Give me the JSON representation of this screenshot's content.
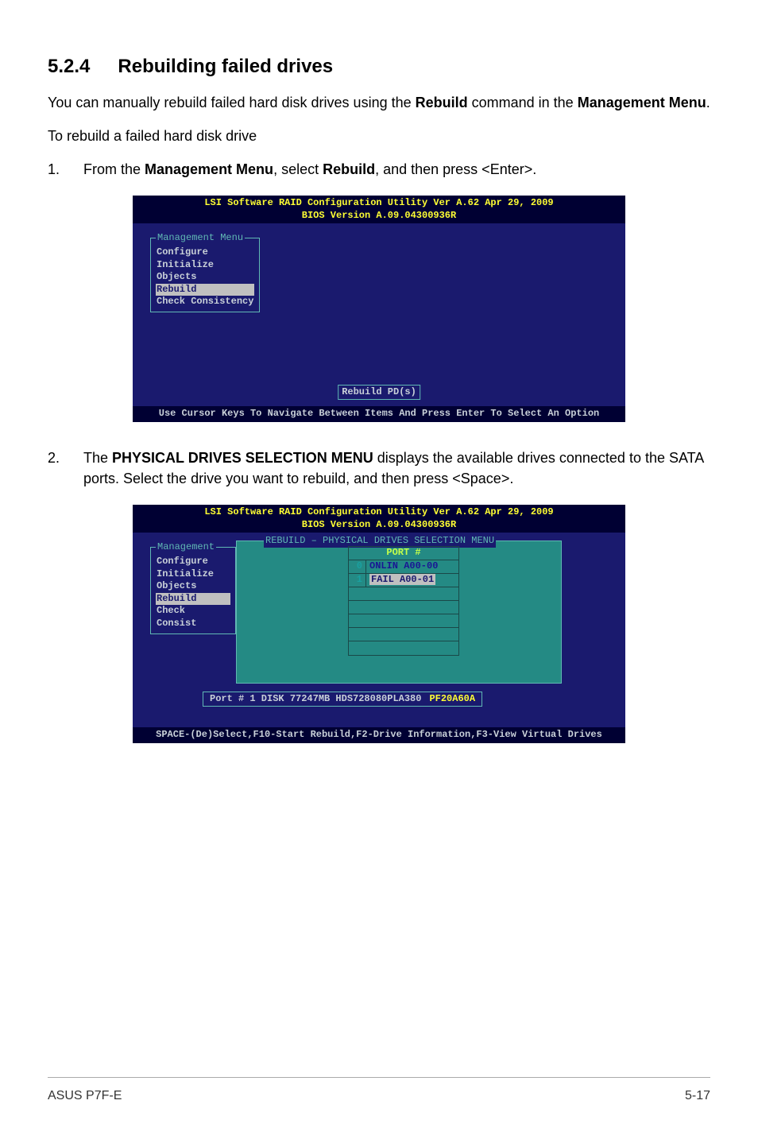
{
  "heading": {
    "number": "5.2.4",
    "title": "Rebuilding failed drives"
  },
  "intro1": "You can manually rebuild failed hard disk drives using the ",
  "intro1_bold1": "Rebuild",
  "intro1_mid": " command in the ",
  "intro1_bold2": "Management Menu",
  "intro1_end": ".",
  "intro2": "To rebuild a failed hard disk drive",
  "step1": {
    "num": "1.",
    "pre": "From the ",
    "b1": "Management Menu",
    "mid": ", select ",
    "b2": "Rebuild",
    "post": ", and then press <Enter>."
  },
  "bios1": {
    "header1": "LSI Software RAID Configuration Utility Ver A.62 Apr 29, 2009",
    "header2": "BIOS Version   A.09.04300936R",
    "menu_title": "Management Menu",
    "items": [
      "Configure",
      "Initialize",
      "Objects",
      "Rebuild",
      "Check Consistency"
    ],
    "selected_index": 3,
    "rebuild_btn": "Rebuild PD(s)",
    "footer": "Use Cursor Keys To Navigate Between Items And Press Enter To Select An Option"
  },
  "step2": {
    "num": "2.",
    "pre": "The ",
    "b1": "PHYSICAL DRIVES SELECTION MENU",
    "post": " displays the available drives connected to the SATA ports. Select the drive you want to rebuild, and then press <Space>."
  },
  "bios2": {
    "header1": "LSI Software RAID Configuration Utility Ver A.62 Apr 29, 2009",
    "header2": "BIOS Version   A.09.04300936R",
    "menu_title": "Management",
    "items": [
      "Configure",
      "Initialize",
      "Objects",
      "Rebuild",
      "Check Consist"
    ],
    "selected_index": 3,
    "panel_title": "REBUILD – PHYSICAL DRIVES SELECTION MENU",
    "port_header": "PORT #",
    "rows": [
      {
        "idx": "0",
        "text": "ONLIN A00-00",
        "fail": false
      },
      {
        "idx": "1",
        "text": "FAIL  A00-01",
        "fail": true
      }
    ],
    "port_info": "Port # 1 DISK   77247MB   HDS728080PLA380",
    "port_info_pf": "PF20A60A",
    "footer": "SPACE-(De)Select,F10-Start Rebuild,F2-Drive Information,F3-View Virtual Drives"
  },
  "footer": {
    "left": "ASUS P7F-E",
    "right": "5-17"
  }
}
